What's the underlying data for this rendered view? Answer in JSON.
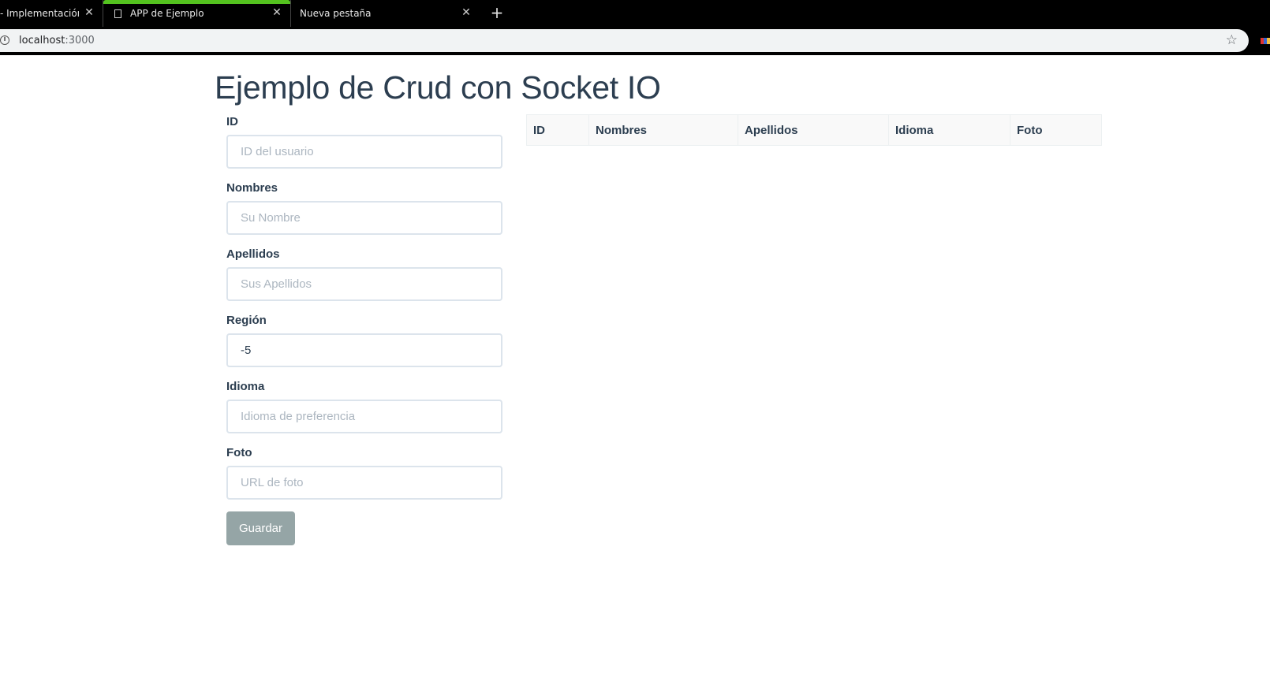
{
  "browser": {
    "tabs": [
      {
        "label": "- Implementación d",
        "active": false
      },
      {
        "label": "APP de Ejemplo",
        "active": true
      },
      {
        "label": "Nueva pestaña",
        "active": false
      }
    ],
    "new_tab_symbol": "+",
    "close_symbol": "✕",
    "address": {
      "host": "localhost",
      "port": ":3000"
    },
    "accent_color": "#54c21f"
  },
  "page": {
    "title": "Ejemplo de Crud con Socket IO"
  },
  "form": {
    "fields": [
      {
        "label": "ID",
        "placeholder": "ID del usuario",
        "value": ""
      },
      {
        "label": "Nombres",
        "placeholder": "Su Nombre",
        "value": ""
      },
      {
        "label": "Apellidos",
        "placeholder": "Sus Apellidos",
        "value": ""
      },
      {
        "label": "Región",
        "placeholder": "",
        "value": "-5"
      },
      {
        "label": "Idioma",
        "placeholder": "Idioma de preferencia",
        "value": ""
      },
      {
        "label": "Foto",
        "placeholder": "URL de foto",
        "value": ""
      }
    ],
    "save_label": "Guardar",
    "save_color": "#95a5a6"
  },
  "table": {
    "headers": [
      "ID",
      "Nombres",
      "Apellidos",
      "Idioma",
      "Foto"
    ],
    "rows": []
  },
  "colors": {
    "text": "#2c3e50",
    "input_border": "#dce4ec"
  }
}
